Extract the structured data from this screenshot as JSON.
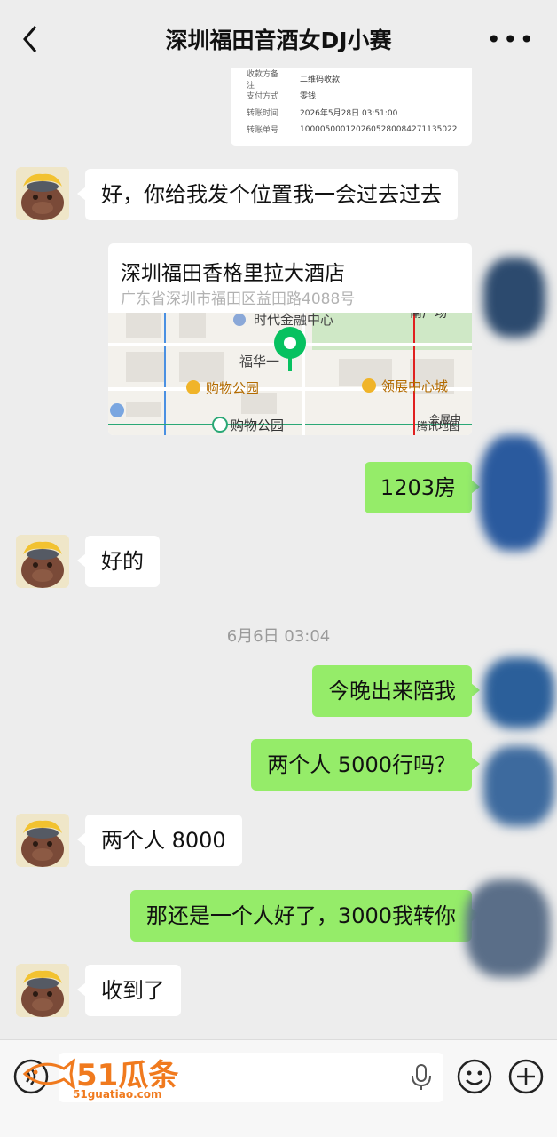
{
  "header": {
    "title": "深圳福田音酒女DJ小赛",
    "back_icon": "chevron-left-icon",
    "more_icon": "more-dots-icon",
    "more_label": "•••"
  },
  "receipt": {
    "rows": [
      {
        "key": "收款方备注",
        "value": "二维码收款"
      },
      {
        "key": "支付方式",
        "value": "零钱"
      },
      {
        "key": "转账时间",
        "value": "2026年5月28日 03:51:00"
      },
      {
        "key": "转账单号",
        "value": "100005000120260528008427113502​2"
      }
    ]
  },
  "messages": {
    "m1": "好，你给我发个位置我一会过去过去",
    "m3": "1203房",
    "m4": "好的",
    "m5": "今晚出来陪我",
    "m6": "两个人 5000行吗？",
    "m7": "两个人 8000",
    "m8": "那还是一个人好了，3000我转你",
    "m9": "收到了"
  },
  "location": {
    "name": "深圳福田香格里拉大酒店",
    "address": "广东省深圳市福田区益田路4088号",
    "map_labels": {
      "finance": "时代金融中心",
      "futian": "福华一",
      "mall1": "购物公园",
      "mall2": "领展中心城",
      "station": "购物公园",
      "square": "南广场",
      "brand": "腾讯地图",
      "edge": "会展中"
    }
  },
  "timestamp": "6月6日 03:04",
  "input_bar": {
    "voice_icon": "voice-icon",
    "mic_icon": "microphone-icon",
    "emoji_icon": "emoji-icon",
    "add_icon": "plus-circle-icon"
  },
  "watermark": {
    "big": "51瓜条",
    "small": "51guatiao.com"
  },
  "colors": {
    "background": "#ededed",
    "outgoing_bubble": "#95ec69",
    "incoming_bubble": "#ffffff",
    "watermark": "#f07a1e"
  }
}
